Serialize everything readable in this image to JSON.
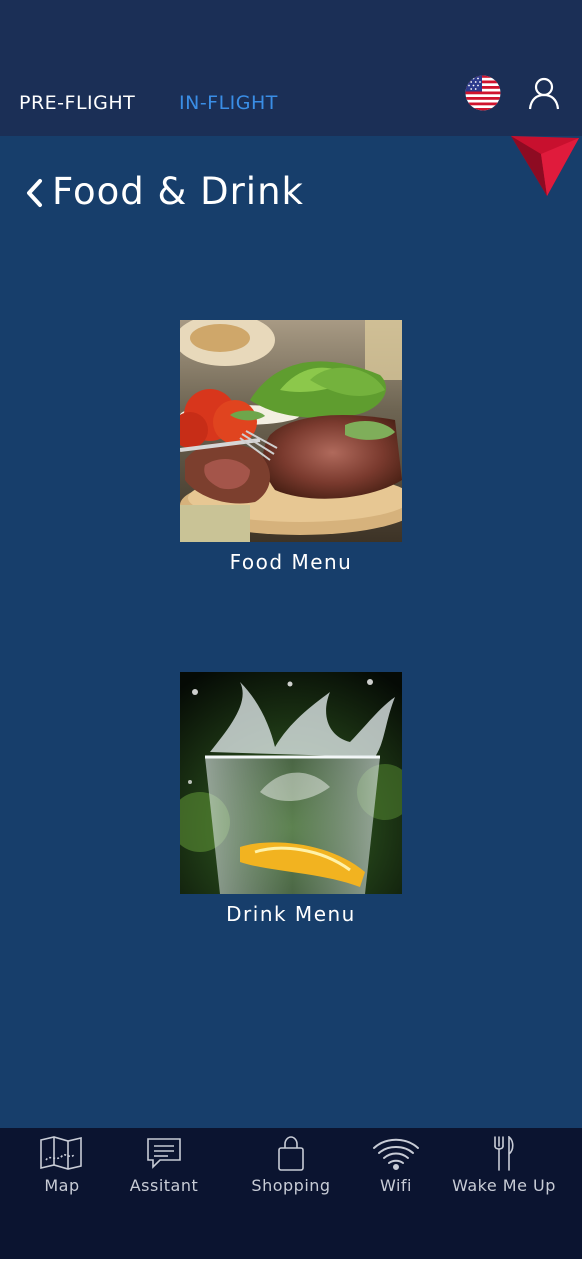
{
  "header": {
    "tabs": [
      {
        "label": "PRE-FLIGHT",
        "active": false
      },
      {
        "label": "IN-FLIGHT",
        "active": true
      }
    ],
    "language_icon": "us-flag-icon",
    "account_icon": "user-icon",
    "brand_icon": "delta-logo-icon"
  },
  "page": {
    "title": "Food & Drink",
    "back_icon": "chevron-left-icon"
  },
  "menus": [
    {
      "label": "Food Menu",
      "image": "steak-dinner-photo"
    },
    {
      "label": "Drink Menu",
      "image": "water-splash-photo"
    }
  ],
  "bottom_nav": [
    {
      "label": "Map",
      "icon": "map-icon"
    },
    {
      "label": "Assitant",
      "icon": "chat-icon"
    },
    {
      "label": "Shopping",
      "icon": "shopping-bag-icon"
    },
    {
      "label": "Wifi",
      "icon": "wifi-icon"
    },
    {
      "label": "Wake Me Up",
      "icon": "utensils-icon"
    }
  ],
  "colors": {
    "background": "#173e6b",
    "header": "#1b2f56",
    "active_tab": "#3a8ee6",
    "bottom_nav": "#0b1430",
    "brand_red": "#c8102e"
  }
}
